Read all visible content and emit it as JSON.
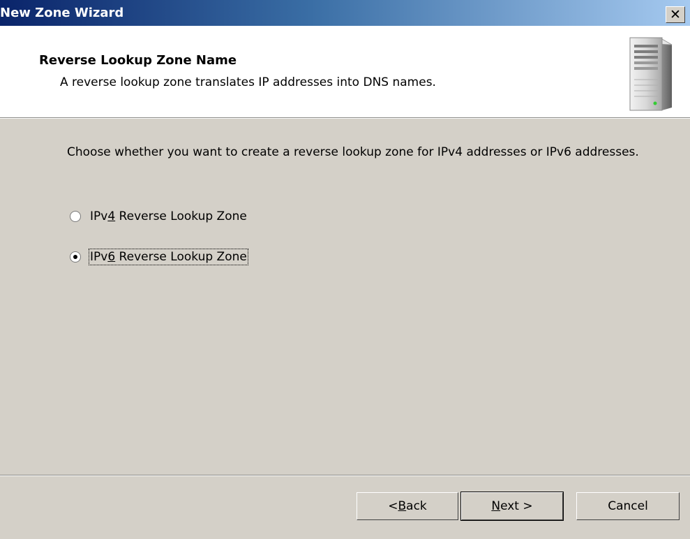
{
  "window": {
    "title": "New Zone Wizard",
    "close_glyph": "✕"
  },
  "header": {
    "title": "Reverse Lookup Zone Name",
    "subtitle": "A reverse lookup zone translates IP addresses into DNS names.",
    "icon": "server-icon"
  },
  "body": {
    "prompt": "Choose whether you want to create a reverse lookup zone for IPv4 addresses or IPv6 addresses.",
    "options": [
      {
        "pre": "IPv",
        "mnemonic": "4",
        "post": " Reverse Lookup Zone",
        "checked": false
      },
      {
        "pre": "IPv",
        "mnemonic": "6",
        "post": " Reverse Lookup Zone",
        "checked": true
      }
    ]
  },
  "buttons": {
    "back": {
      "pre": "< ",
      "mnemonic": "B",
      "post": "ack"
    },
    "next": {
      "pre": "",
      "mnemonic": "N",
      "post": "ext >"
    },
    "cancel": "Cancel"
  }
}
